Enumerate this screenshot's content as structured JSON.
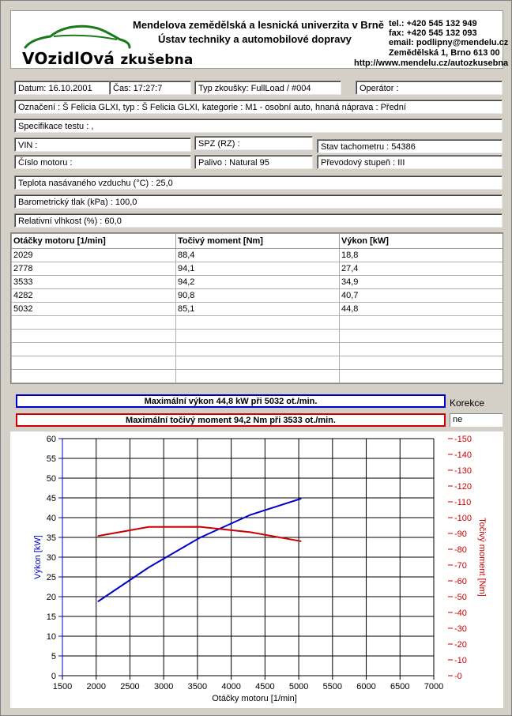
{
  "header": {
    "university": "Mendelova zemědělská a lesnická univerzita v Brně",
    "institute": "Ústav techniky a automobilové dopravy",
    "logo_text_a": "VOzidlOvá",
    "logo_text_b": "zkušebna",
    "tel": "tel.: +420 545 132 949",
    "fax": "fax: +420 545 132 093",
    "email": "email: podlipny@mendelu.cz",
    "address": "Zemědělská 1, Brno 613 00",
    "web": "http://www.mendelu.cz/autozkusebna"
  },
  "info": {
    "date": "Datum: 16.10.2001",
    "time": "Čas: 17:27:7",
    "test_type": "Typ zkoušky: FullLoad / #004",
    "operator": "Operátor :",
    "designation": "Označení : Š Felicia GLXI, typ : Š Felicia GLXI, kategorie : M1 - osobní auto, hnaná náprava : Přední",
    "spec": "Specifikace testu : ,",
    "vin": "VIN :",
    "spz": "SPZ (RZ) :",
    "odometer": "Stav tachometru : 54386",
    "engine_no": "Číslo motoru :",
    "fuel": "Palivo : Natural 95",
    "gear": "Převodový stupeň : III",
    "temp": "Teplota nasávaného vzduchu (°C) : 25,0",
    "pressure": "Barometrický tlak (kPa) : 100,0",
    "humidity": "Relativní vlhkost (%) : 60,0"
  },
  "table": {
    "headers": [
      "Otáčky motoru [1/min]",
      "Točivý moment [Nm]",
      "Výkon [kW]"
    ],
    "rows": [
      [
        "2029",
        "88,4",
        "18,8"
      ],
      [
        "2778",
        "94,1",
        "27,4"
      ],
      [
        "3533",
        "94,2",
        "34,9"
      ],
      [
        "4282",
        "90,8",
        "40,7"
      ],
      [
        "5032",
        "85,1",
        "44,8"
      ]
    ],
    "empty_rows": 5
  },
  "summary": {
    "max_power": "Maximální výkon 44,8 kW při 5032 ot./min.",
    "max_torque": "Maximální točivý moment 94,2 Nm při 3533 ot./min.",
    "korekce_label": "Korekce",
    "korekce_value": "ne"
  },
  "colors": {
    "power": "#0000cc",
    "torque": "#cc0000",
    "background": "#d4d0c8"
  },
  "chart_data": {
    "type": "line",
    "xlabel": "Otáčky motoru [1/min]",
    "ylabel_left": "Výkon [kW]",
    "ylabel_right": "Točivý moment [Nm]",
    "xlim": [
      1500,
      7000
    ],
    "xticks": [
      1500,
      2000,
      2500,
      3000,
      3500,
      4000,
      4500,
      5000,
      5500,
      6000,
      6500,
      7000
    ],
    "ylim_left": [
      0,
      60
    ],
    "yticks_left": [
      0,
      5,
      10,
      15,
      20,
      25,
      30,
      35,
      40,
      45,
      50,
      55,
      60
    ],
    "ylim_right": [
      0,
      150
    ],
    "yticks_right": [
      0,
      10,
      20,
      30,
      40,
      50,
      60,
      70,
      80,
      90,
      100,
      110,
      120,
      130,
      140,
      150
    ],
    "grid": true,
    "series": [
      {
        "axis": "left",
        "color": "#0000cc",
        "x": [
          2029,
          2778,
          3533,
          4282,
          5032
        ],
        "values": [
          18.8,
          27.4,
          34.9,
          40.7,
          44.8
        ]
      },
      {
        "axis": "right",
        "color": "#cc0000",
        "x": [
          2029,
          2778,
          3533,
          4282,
          5032
        ],
        "values": [
          88.4,
          94.1,
          94.2,
          90.8,
          85.1
        ]
      }
    ]
  }
}
